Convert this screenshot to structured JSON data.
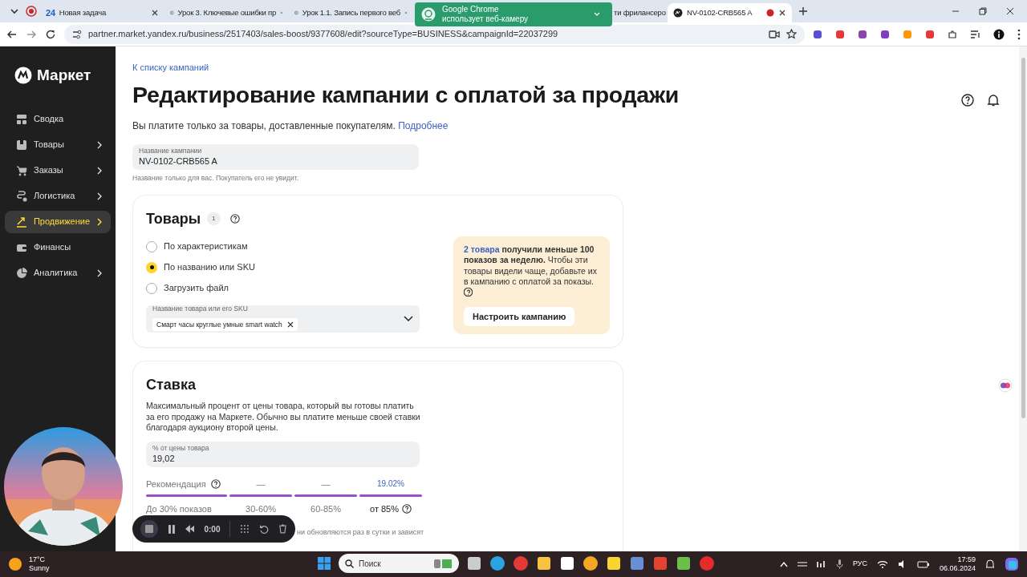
{
  "browser": {
    "tabs": [
      {
        "title": "Новая задача",
        "badge": "24",
        "selected": false
      },
      {
        "title": "Урок 3. Ключевые ошибки пр",
        "selected": false
      },
      {
        "title": "Урок 1.1. Запись первого веб",
        "selected": false
      },
      {
        "title": "ти фрилансеро",
        "selected": false
      },
      {
        "title": "NV-0102-CRB565 A",
        "selected": true
      }
    ],
    "url": "partner.market.yandex.ru/business/2517403/sales-boost/9377608/edit?sourceType=BUSINESS&campaignId=22037299",
    "notification": {
      "title": "Google Chrome",
      "text": "использует веб-камеру"
    }
  },
  "sidebar": {
    "logo": "Маркет",
    "items": [
      {
        "label": "Сводка",
        "expandable": false,
        "selected": false
      },
      {
        "label": "Товары",
        "expandable": true,
        "selected": false
      },
      {
        "label": "Заказы",
        "expandable": true,
        "selected": false
      },
      {
        "label": "Логистика",
        "expandable": true,
        "selected": false
      },
      {
        "label": "Продвижение",
        "expandable": true,
        "selected": true
      },
      {
        "label": "Финансы",
        "expandable": false,
        "selected": false
      },
      {
        "label": "Аналитика",
        "expandable": true,
        "selected": false
      }
    ]
  },
  "page": {
    "back_link": "К списку кампаний",
    "title": "Редактирование кампании с оплатой за продажи",
    "intro": "Вы платите только за товары, доставленные покупателям.",
    "intro_link": "Подробнее",
    "name_field": {
      "label": "Название кампании",
      "value": "NV-0102-CRB565 A",
      "hint": "Название только для вас. Покупатель его не увидит."
    },
    "products": {
      "title": "Товары",
      "count": "1",
      "options": [
        {
          "label": "По характеристикам",
          "selected": false
        },
        {
          "label": "По названию или SKU",
          "selected": true
        },
        {
          "label": "Загрузить файл",
          "selected": false
        }
      ],
      "select": {
        "label": "Название товара или его SKU",
        "chips": [
          "Смарт часы круглые умные smart watch"
        ]
      },
      "notice": {
        "link": "2 товара",
        "text": "**получили меньше 100 показов за неделю.** Чтобы эти товары видели чаще, добавьте их в кампанию с оплатой за показы.",
        "button": "Настроить кампанию"
      }
    },
    "bid": {
      "title": "Ставка",
      "description": "Максимальный процент от цены товара, который вы готовы платить за его продажу на Маркете. Обычно вы платите меньше своей ставки благодаря аукциону второй цены.",
      "field": {
        "label": "% от цены товара",
        "value": "19,02"
      },
      "recommendation_label": "Рекомендация",
      "tiers": [
        {
          "label": "До 30% показов"
        },
        {
          "value": "—",
          "label": "30-60%"
        },
        {
          "value": "—",
          "label": "60-85%"
        },
        {
          "value": "19.02%",
          "label": "от 85%"
        }
      ],
      "note": "ни обновляются раз в сутки и зависят"
    }
  },
  "recorder": {
    "time": "0:00"
  },
  "taskbar": {
    "weather": {
      "temp": "17°C",
      "text": "Sunny"
    },
    "search": "Поиск",
    "language": "РУС",
    "time": "17:59",
    "date": "06.06.2024"
  }
}
